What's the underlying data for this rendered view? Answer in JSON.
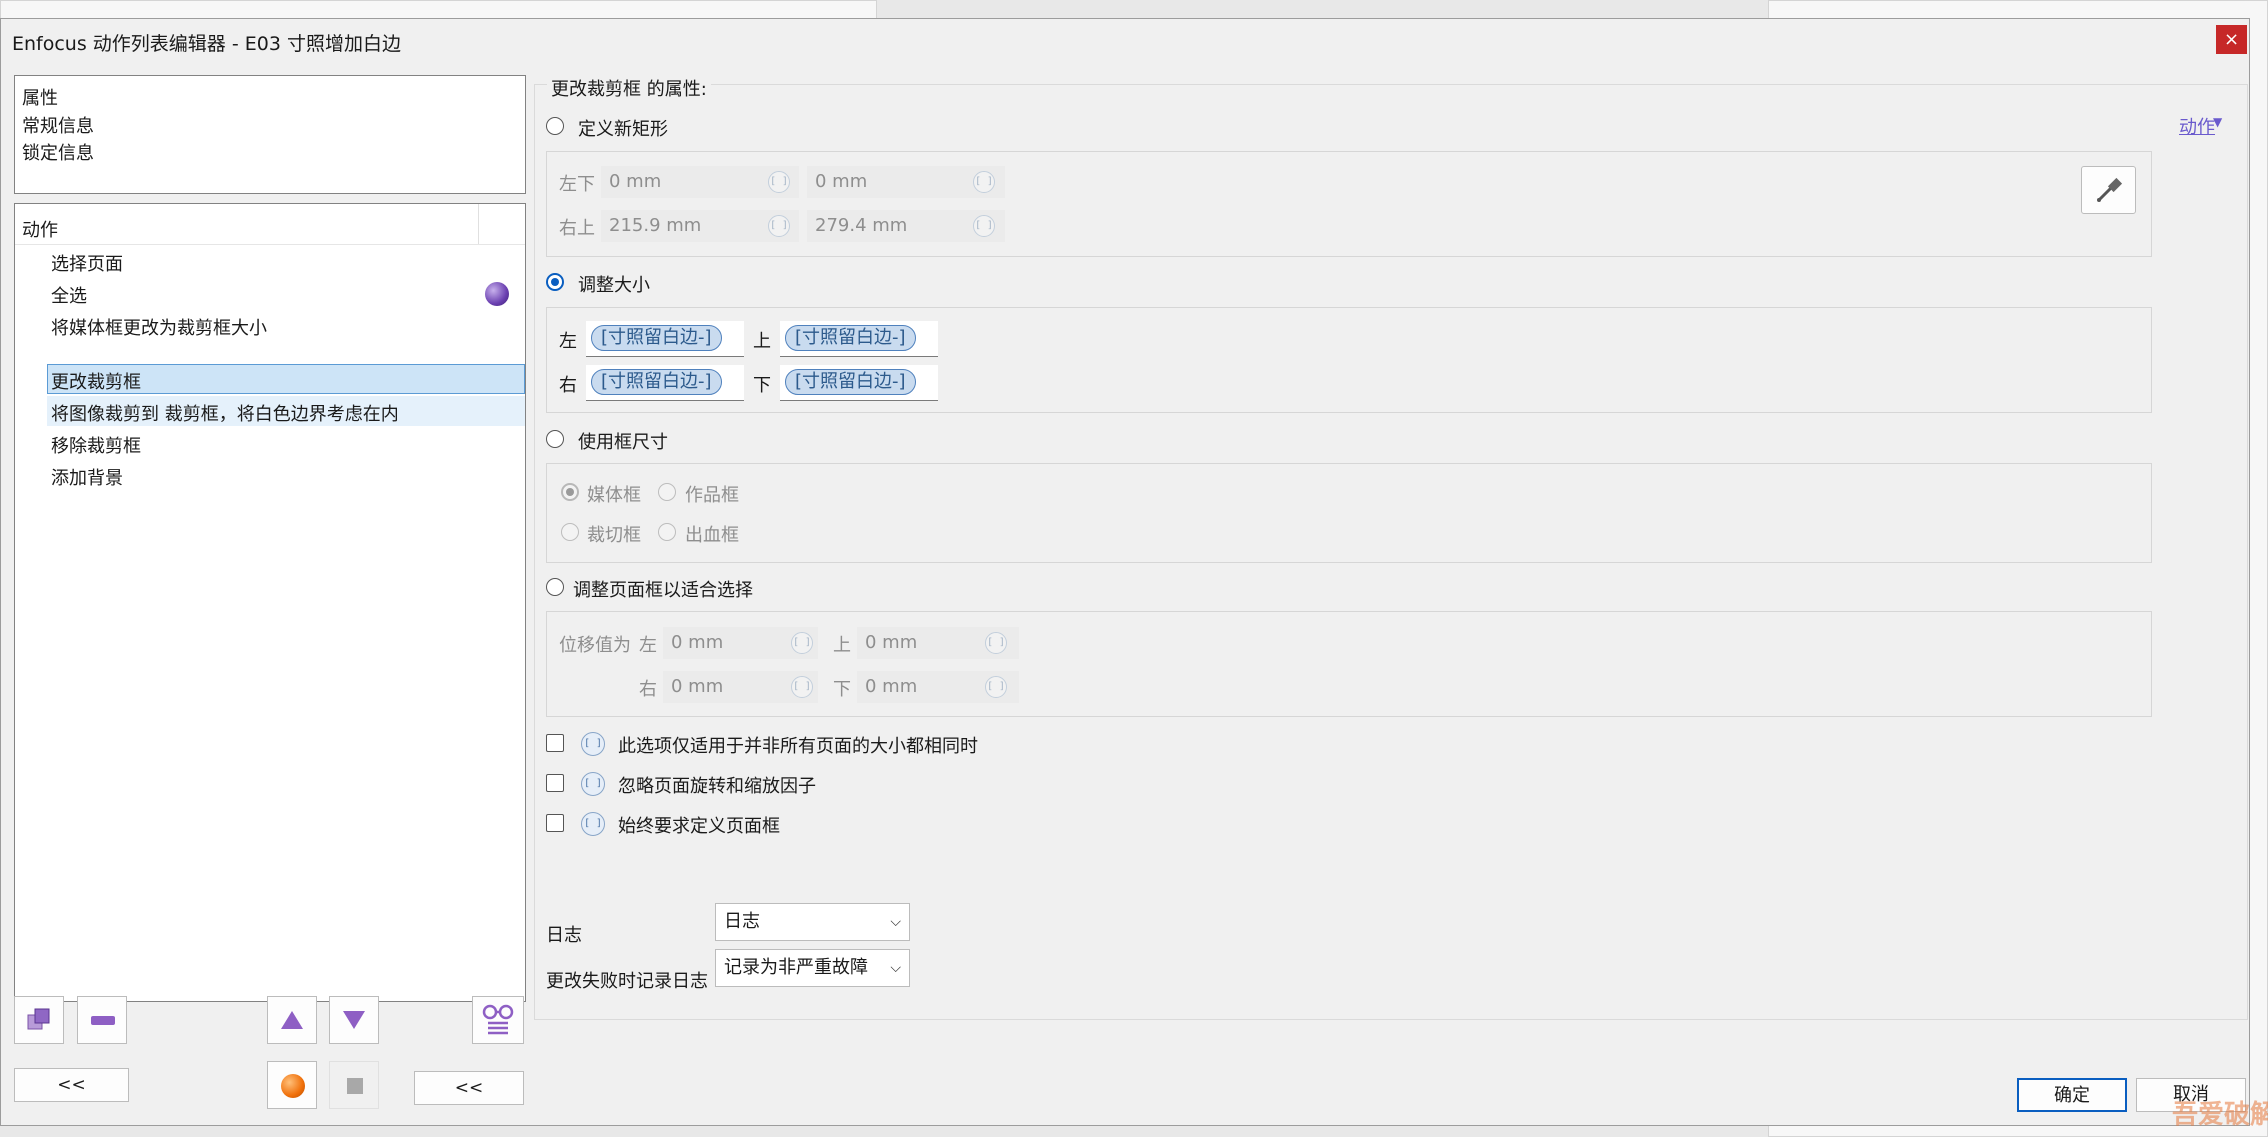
{
  "window": {
    "title": "Enfocus 动作列表编辑器 - E03 寸照增加白边",
    "close_label": "×"
  },
  "properties_panel": {
    "header": "属性",
    "items": [
      "常规信息",
      "锁定信息"
    ]
  },
  "actions_panel": {
    "header": "动作",
    "items": [
      "选择页面",
      "全选",
      "将媒体框更改为裁剪框大小",
      "更改裁剪框",
      "将图像裁剪到 裁剪框，将白色边界考虑在内",
      "移除裁剪框",
      "添加背景"
    ],
    "selected_index": 3
  },
  "left_buttons": {
    "collapse_label_1": "<<",
    "collapse_label_2": "<<"
  },
  "right": {
    "section_title": "更改裁剪框 的属性:",
    "action_menu_label": "动作",
    "define_rect": {
      "label": "定义新矩形",
      "lower_left_label": "左下",
      "upper_right_label": "右上",
      "ll_x": "0 mm",
      "ll_y": "0 mm",
      "ur_x": "215.9 mm",
      "ur_y": "279.4 mm",
      "var_glyph": "[ ]"
    },
    "resize": {
      "label": "调整大小",
      "left_label": "左",
      "top_label": "上",
      "right_label": "右",
      "bottom_label": "下",
      "token": "[寸照留白边-]"
    },
    "use_box": {
      "label": "使用框尺寸",
      "media_box": "媒体框",
      "art_box": "作品框",
      "trim_box": "裁切框",
      "bleed_box": "出血框"
    },
    "fit_selection": {
      "label": "调整页面框以适合选择",
      "offset_label": "位移值为",
      "left_label": "左",
      "top_label": "上",
      "right_label": "右",
      "bottom_label": "下",
      "left": "0 mm",
      "top": "0 mm",
      "right": "0 mm",
      "bottom": "0 mm"
    },
    "checkboxes": [
      "此选项仅适用于并非所有页面的大小都相同时",
      "忽略页面旋转和缩放因子",
      "始终要求定义页面框"
    ],
    "log": {
      "label": "日志",
      "value": "日志",
      "fail_label": "更改失败时记录日志",
      "fail_value": "记录为非严重故障"
    },
    "ok_label": "确定",
    "cancel_label": "取消"
  },
  "watermark": "吾爱破解"
}
